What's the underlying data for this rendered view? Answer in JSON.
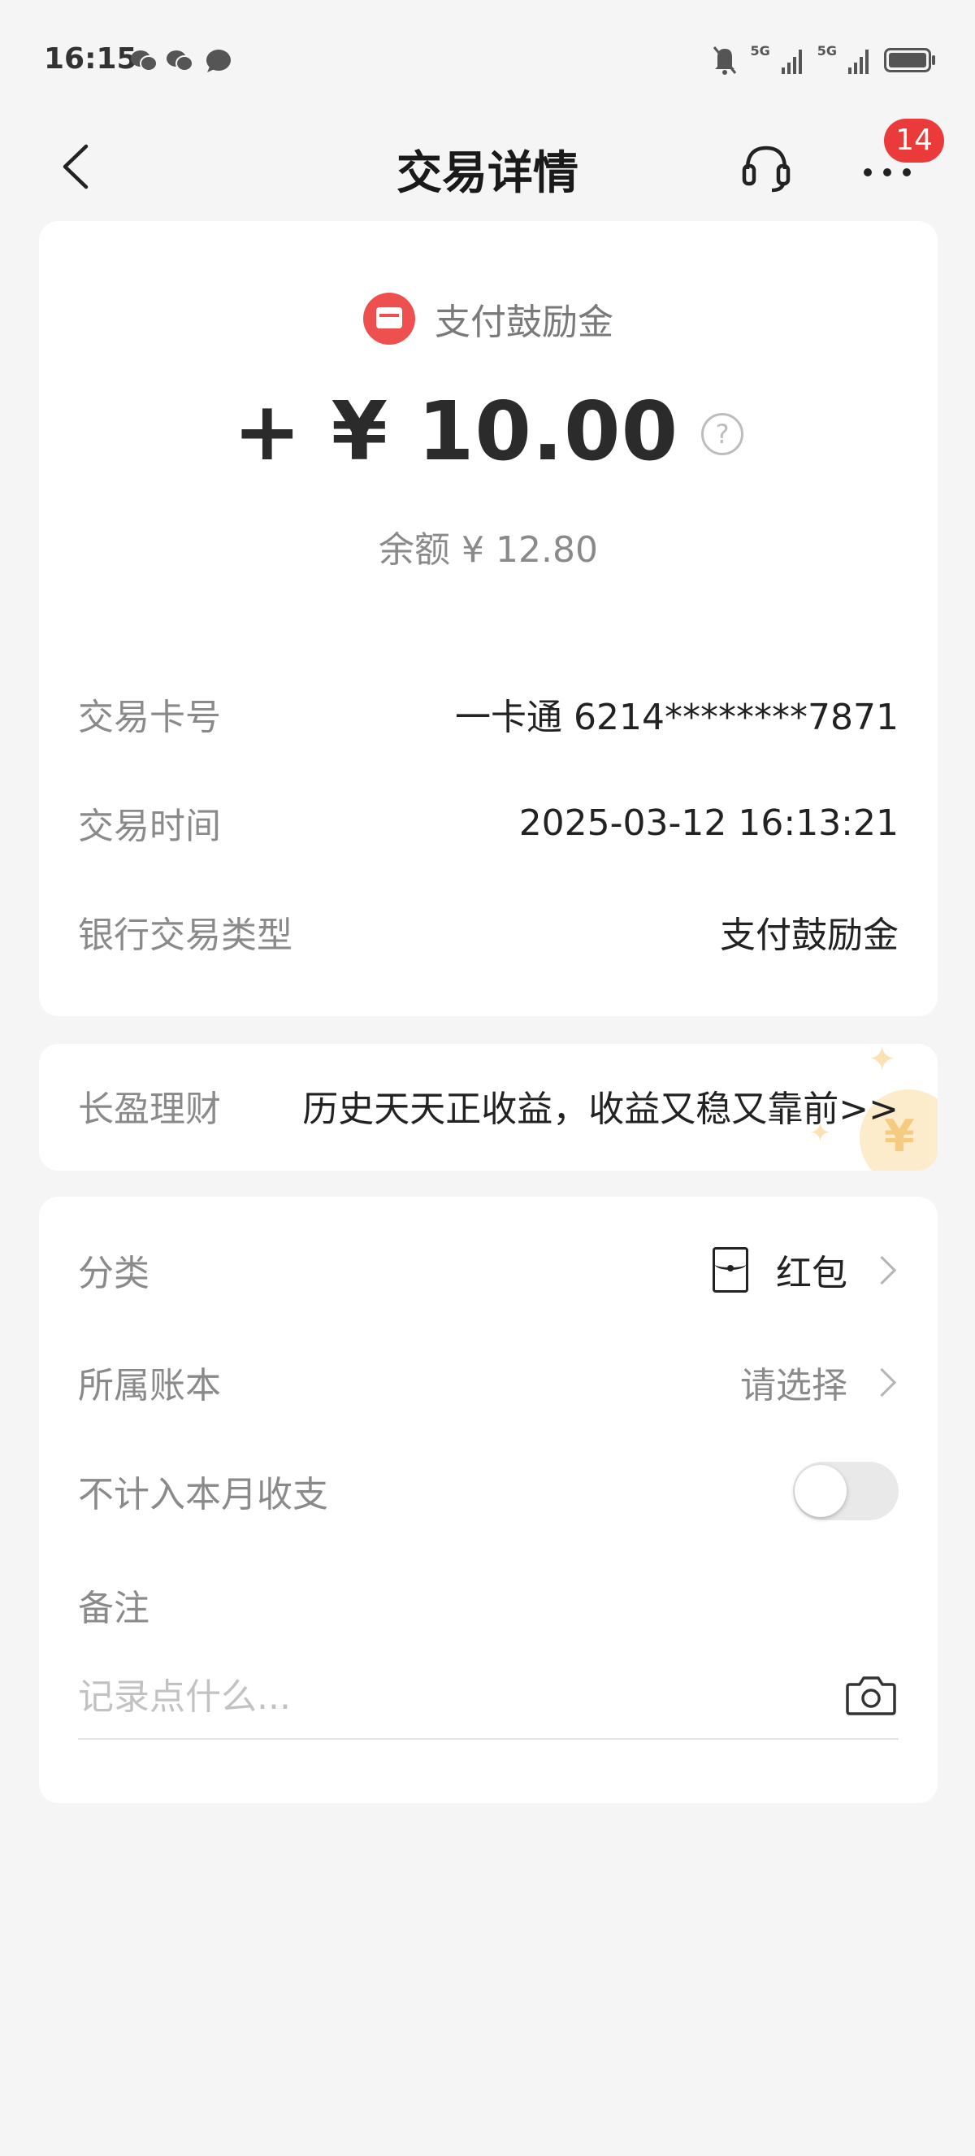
{
  "status_bar": {
    "time": "16:15",
    "network_1": "5G",
    "network_2": "5G"
  },
  "header": {
    "title": "交易详情",
    "badge_count": "14"
  },
  "transaction": {
    "type_label": "支付鼓励金",
    "amount": "+ ¥ 10.00",
    "help_symbol": "?",
    "balance": "余额 ¥ 12.80",
    "details": [
      {
        "label": "交易卡号",
        "value": "一卡通 6214********7871"
      },
      {
        "label": "交易时间",
        "value": "2025-03-12 16:13:21"
      },
      {
        "label": "银行交易类型",
        "value": "支付鼓励金"
      }
    ]
  },
  "promo": {
    "label": "长盈理财",
    "text": "历史天天正收益，收益又稳又靠前>>",
    "coin_symbol": "¥"
  },
  "settings": {
    "category_label": "分类",
    "category_value": "红包",
    "ledger_label": "所属账本",
    "ledger_value": "请选择",
    "exclude_label": "不计入本月收支",
    "exclude_on": false,
    "note_label": "备注",
    "note_placeholder": "记录点什么..."
  },
  "colors": {
    "accent_red": "#ee4f4f",
    "badge_red": "#ea3a3a",
    "background": "#f5f5f6"
  }
}
